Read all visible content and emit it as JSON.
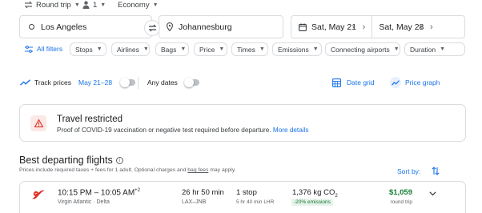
{
  "search_options": {
    "trip_type": "Round trip",
    "passengers": "1",
    "cabin_class": "Economy"
  },
  "search": {
    "origin": "Los Angeles",
    "destination": "Johannesburg",
    "depart_date": "Sat, May 21",
    "return_date": "Sat, May 28"
  },
  "filters": {
    "all_filters": "All filters",
    "chips": [
      "Stops",
      "Airlines",
      "Bags",
      "Price",
      "Times",
      "Emissions",
      "Connecting airports",
      "Duration"
    ]
  },
  "tracking": {
    "track_prices_label": "Track prices",
    "date_range": "May 21–28",
    "any_dates_label": "Any dates",
    "date_grid": "Date grid",
    "price_graph": "Price graph"
  },
  "restriction": {
    "title": "Travel restricted",
    "text": "Proof of COVID-19 vaccination or negative test required before departure.",
    "link": "More details"
  },
  "results": {
    "heading": "Best departing flights",
    "note_prefix": "Prices include required taxes + fees for 1 adult. Optional charges and",
    "note_link": "bag fees",
    "note_suffix": "may apply.",
    "sort_label": "Sort by:"
  },
  "flights": [
    {
      "times": "10:15 PM – 10:05 AM",
      "day_offset": "+2",
      "airlines": "Virgin Atlantic · Delta",
      "duration": "26 hr 50 min",
      "route": "LAX–JNB",
      "stops": "1 stop",
      "layover": "5 hr 40 min LHR",
      "emissions": "1,376 kg CO",
      "emissions_sub": "2",
      "emissions_badge": "-20% emissions",
      "price": "$1,059",
      "price_type": "round trip"
    }
  ],
  "colors": {
    "accent": "#1a73e8",
    "price_green": "#188038",
    "warning_red": "#d93025",
    "badge_bg": "#e6f4ea"
  }
}
